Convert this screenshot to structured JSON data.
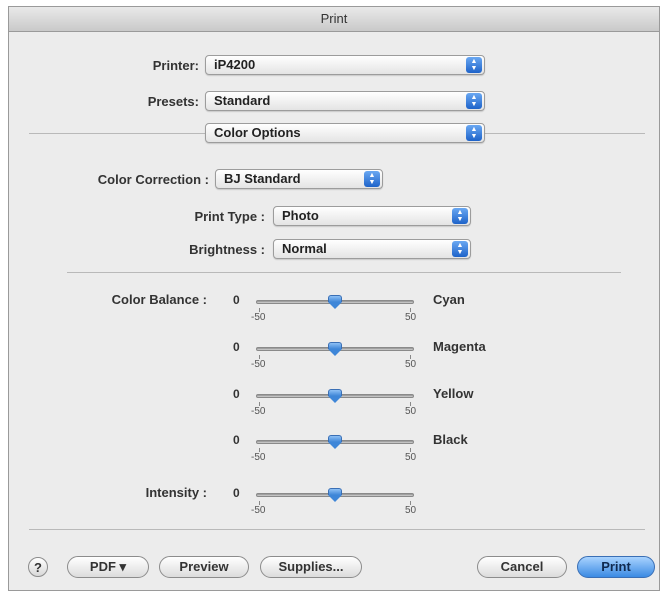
{
  "window": {
    "title": "Print"
  },
  "printer": {
    "label": "Printer:",
    "value": "iP4200"
  },
  "presets": {
    "label": "Presets:",
    "value": "Standard"
  },
  "panel": {
    "value": "Color Options"
  },
  "color_correction": {
    "label": "Color Correction :",
    "value": "BJ Standard"
  },
  "print_type": {
    "label": "Print Type :",
    "value": "Photo"
  },
  "brightness": {
    "label": "Brightness :",
    "value": "Normal"
  },
  "color_balance": {
    "label": "Color Balance :",
    "sliders": [
      {
        "name": "Cyan",
        "value": "0",
        "min": "-50",
        "max": "50",
        "level": 0.5
      },
      {
        "name": "Magenta",
        "value": "0",
        "min": "-50",
        "max": "50",
        "level": 0.5
      },
      {
        "name": "Yellow",
        "value": "0",
        "min": "-50",
        "max": "50",
        "level": 0.5
      },
      {
        "name": "Black",
        "value": "0",
        "min": "-50",
        "max": "50",
        "level": 0.5
      }
    ]
  },
  "intensity": {
    "label": "Intensity :",
    "value": "0",
    "min": "-50",
    "max": "50",
    "level": 0.5
  },
  "buttons": {
    "help": "?",
    "pdf": "PDF ▾",
    "preview": "Preview",
    "supplies": "Supplies...",
    "cancel": "Cancel",
    "print": "Print"
  },
  "colors": {
    "accent": "#3b8ae3"
  },
  "icons": {
    "popup": "up-down-arrows-icon",
    "slider_thumb": "slider-thumb-icon",
    "help": "question-icon"
  }
}
